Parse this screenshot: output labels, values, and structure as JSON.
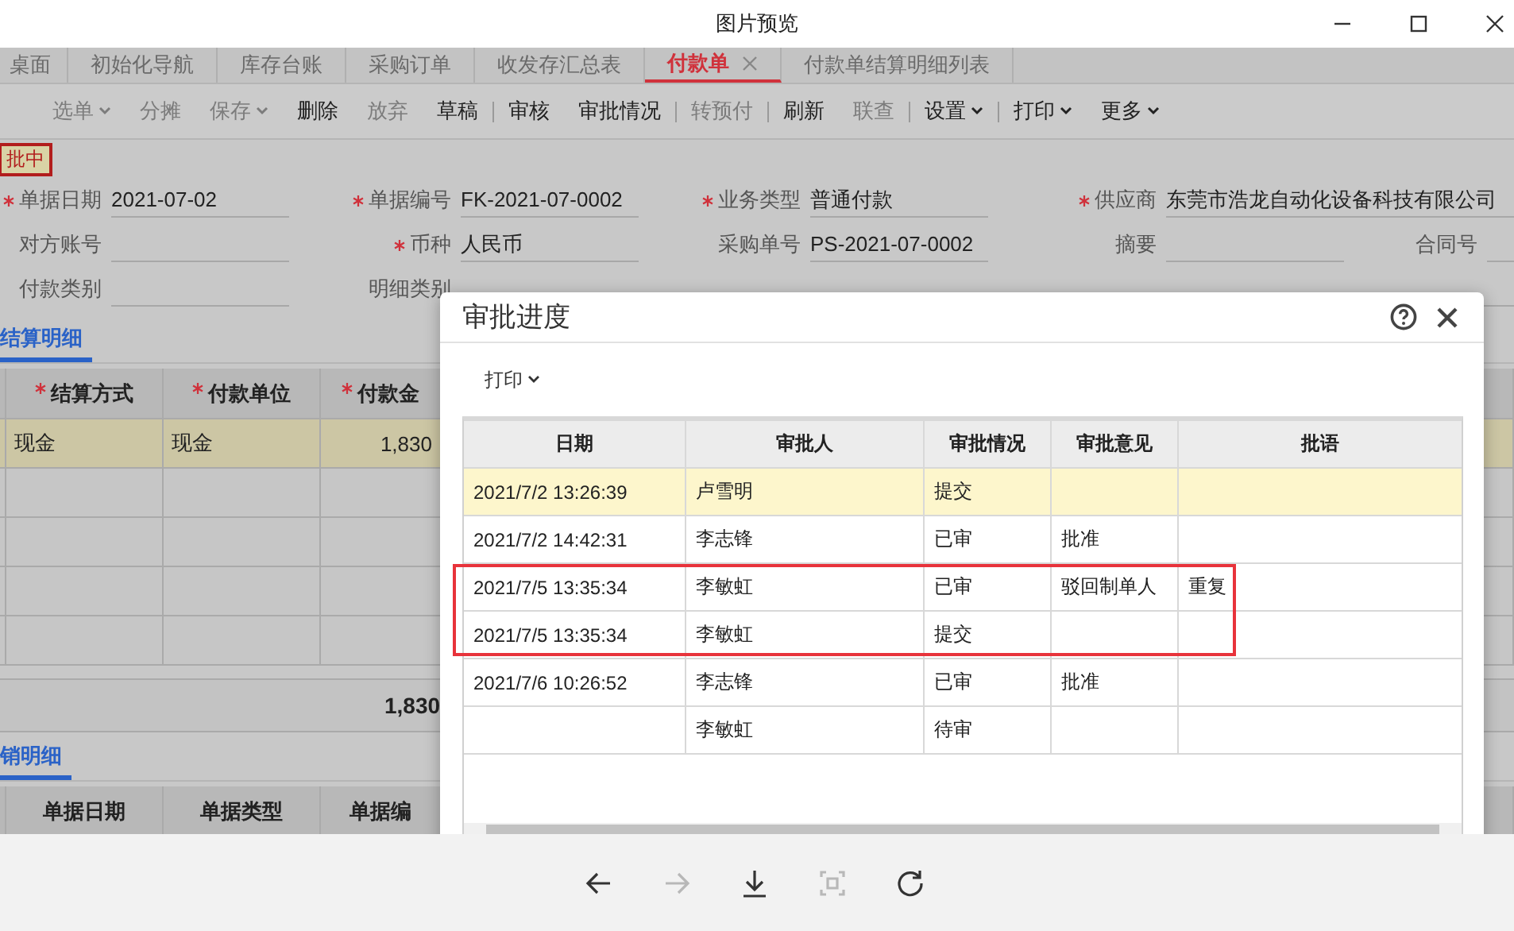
{
  "window": {
    "title": "图片预览"
  },
  "screenshot": {
    "tabs": [
      {
        "label": "桌面",
        "selected": false,
        "closable": false
      },
      {
        "label": "初始化导航",
        "selected": false,
        "closable": false
      },
      {
        "label": "库存台账",
        "selected": false,
        "closable": false
      },
      {
        "label": "采购订单",
        "selected": false,
        "closable": false
      },
      {
        "label": "收发存汇总表",
        "selected": false,
        "closable": false
      },
      {
        "label": "付款单",
        "selected": true,
        "closable": true
      },
      {
        "label": "付款单结算明细列表",
        "selected": false,
        "closable": false
      }
    ],
    "toolbar": [
      {
        "label": "选单",
        "dropdown": true,
        "disabled": true,
        "divider": false
      },
      {
        "label": "分摊",
        "dropdown": false,
        "disabled": true,
        "divider": false
      },
      {
        "label": "保存",
        "dropdown": true,
        "disabled": true,
        "divider": false
      },
      {
        "label": "删除",
        "dropdown": false,
        "disabled": false,
        "divider": false
      },
      {
        "label": "放弃",
        "dropdown": false,
        "disabled": true,
        "divider": false
      },
      {
        "label": "草稿",
        "dropdown": false,
        "disabled": false,
        "divider": false
      },
      {
        "label": "审核",
        "dropdown": false,
        "disabled": false,
        "divider": true
      },
      {
        "label": "审批情况",
        "dropdown": false,
        "disabled": false,
        "divider": false
      },
      {
        "label": "转预付",
        "dropdown": false,
        "disabled": true,
        "divider": true
      },
      {
        "label": "刷新",
        "dropdown": false,
        "disabled": false,
        "divider": true
      },
      {
        "label": "联查",
        "dropdown": false,
        "disabled": true,
        "divider": false
      },
      {
        "label": "设置",
        "dropdown": true,
        "disabled": false,
        "divider": true
      },
      {
        "label": "打印",
        "dropdown": true,
        "disabled": false,
        "divider": true
      },
      {
        "label": "更多",
        "dropdown": true,
        "disabled": false,
        "divider": false
      }
    ],
    "status_badge": "批中",
    "form_rows": [
      [
        {
          "label": "单据日期",
          "required": true,
          "value": "2021-07-02"
        },
        {
          "label": "单据编号",
          "required": true,
          "value": "FK-2021-07-0002"
        },
        {
          "label": "业务类型",
          "required": true,
          "value": "普通付款"
        },
        {
          "label": "供应商",
          "required": true,
          "value": "东莞市浩龙自动化设备科技有限公司"
        }
      ],
      [
        {
          "label": "对方账号",
          "required": false
        },
        {
          "label": "币种",
          "required": true,
          "value": "人民币"
        },
        {
          "label": "采购单号",
          "required": false,
          "value": "PS-2021-07-0002"
        },
        {
          "label": "摘要",
          "required": false
        },
        {
          "label": "合同号",
          "required": false
        }
      ],
      [
        {
          "label": "付款类别",
          "required": false
        },
        {
          "label": "明细类别",
          "required": false
        }
      ]
    ],
    "settlement": {
      "title": "结算明细",
      "columns": [
        {
          "label": "结算方式",
          "required": true
        },
        {
          "label": "付款单位",
          "required": true
        },
        {
          "label": "付款金",
          "required": true
        }
      ],
      "rows": [
        {
          "cells": [
            "现金",
            "现金",
            "1,830"
          ],
          "selected": true
        },
        {
          "cells": [
            "",
            "",
            ""
          ],
          "selected": false
        },
        {
          "cells": [
            "",
            "",
            ""
          ],
          "selected": false
        },
        {
          "cells": [
            "",
            "",
            ""
          ],
          "selected": false
        },
        {
          "cells": [
            "",
            "",
            ""
          ],
          "selected": false
        }
      ],
      "total": "1,830"
    },
    "writeoff": {
      "title": "销明细",
      "columns": [
        {
          "label": "单据日期",
          "required": false
        },
        {
          "label": "单据类型",
          "required": false
        },
        {
          "label": "单据编",
          "required": false
        }
      ]
    }
  },
  "dialog": {
    "title": "审批进度",
    "print_menu": "打印",
    "columns": [
      "日期",
      "审批人",
      "审批情况",
      "审批意见",
      "批语"
    ],
    "rows": [
      {
        "cells": [
          "2021/7/2 13:26:39",
          "卢雪明",
          "提交",
          "",
          ""
        ],
        "selected": true
      },
      {
        "cells": [
          "2021/7/2 14:42:31",
          "李志锋",
          "已审",
          "批准",
          ""
        ],
        "selected": false
      },
      {
        "cells": [
          "2021/7/5 13:35:34",
          "李敏虹",
          "已审",
          "驳回制单人",
          "重复"
        ],
        "selected": false
      },
      {
        "cells": [
          "2021/7/5 13:35:34",
          "李敏虹",
          "提交",
          "",
          ""
        ],
        "selected": false
      },
      {
        "cells": [
          "2021/7/6 10:26:52",
          "李志锋",
          "已审",
          "批准",
          ""
        ],
        "selected": false
      },
      {
        "cells": [
          "",
          "李敏虹",
          "待审",
          "",
          ""
        ],
        "selected": false
      }
    ]
  },
  "viewer_toolbar": [
    {
      "kind": "back",
      "disabled": false
    },
    {
      "kind": "forward",
      "disabled": true
    },
    {
      "kind": "download",
      "disabled": false
    },
    {
      "kind": "fit",
      "disabled": true
    },
    {
      "kind": "rotate",
      "disabled": false
    }
  ]
}
